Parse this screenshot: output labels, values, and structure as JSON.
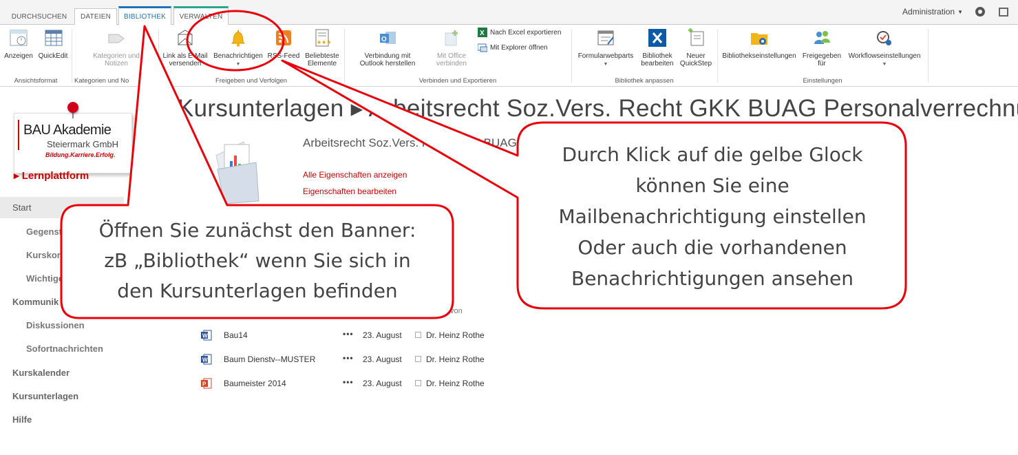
{
  "tabs": [
    {
      "label": "DURCHSUCHEN"
    },
    {
      "label": "DATEIEN"
    },
    {
      "label": "BIBLIOTHEK"
    },
    {
      "label": "VERWALTEN"
    }
  ],
  "header": {
    "user_menu": "Administration"
  },
  "ribbon": {
    "buttons": {
      "anzeigen": "Anzeigen",
      "quickedit": "QuickEdit",
      "kategorien": "Kategorien und Notizen",
      "link_mail": "Link als E-Mail versenden",
      "benachrichtigen": "Benachrichtigen",
      "rss": "RSS-Feed",
      "beliebteste": "Beliebteste Elemente",
      "outlook": "Verbindung mit Outlook herstellen",
      "office": "Mit Office verbinden",
      "excel": "Nach Excel exportieren",
      "explorer": "Mit Explorer öffnen",
      "formular": "Formularwebparts",
      "bibliothek_bearbeiten": "Bibliothek bearbeiten",
      "quickstep": "Neuer QuickStep",
      "bib_einstellungen": "Bibliothekseinstellungen",
      "freigegeben": "Freigegeben für",
      "workflow": "Workflowseinstellungen"
    },
    "groups": {
      "ansichtsformat": "Ansichtsformat",
      "kategorien": "Kategorien und No",
      "freigeben": "Freigeben und Verfolgen",
      "verbinden": "Verbinden und Exportieren",
      "anpassen": "Bibliothek anpassen",
      "einstellungen": "Einstellungen"
    }
  },
  "logo": {
    "line1": "BAU Akademie",
    "line2": "Steiermark GmbH",
    "tagline": "Bildung.Karriere.Erfolg.",
    "platform": "▸ Lernplattform"
  },
  "nav": {
    "start": "Start",
    "gegenst": "Gegenst",
    "kurskon": "Kurskon",
    "wichtige": "Wichtige",
    "kommunik": "Kommunik",
    "diskussionen": "Diskussionen",
    "sofortnachrichten": "Sofortnachrichten",
    "kurskalender": "Kurskalender",
    "kursunterlagen": "Kursunterlagen",
    "hilfe": "Hilfe"
  },
  "main": {
    "title": "Kursunterlagen ▸ Arbeitsrecht Soz.Vers. Recht GKK BUAG Personalverrechnu",
    "doc_title": "Arbeitsrecht Soz.Vers. Recht GKK BUAG",
    "link_all": "Alle Eigenschaften anzeigen",
    "link_edit": "Eigenschaften bearbeiten",
    "col_geaendert_von": "von"
  },
  "files": [
    {
      "name": "Bau14",
      "dots": "•••",
      "date": "23. August",
      "author": "Dr. Heinz Rothe",
      "type": "word"
    },
    {
      "name": "Baum Dienstv--MUSTER",
      "dots": "•••",
      "date": "23. August",
      "author": "Dr. Heinz Rothe",
      "type": "word"
    },
    {
      "name": "Baumeister 2014",
      "dots": "•••",
      "date": "23. August",
      "author": "Dr. Heinz Rothe",
      "type": "ppt"
    }
  ],
  "callouts": {
    "left": [
      "Öffnen Sie zunächst den Banner:",
      "zB „Bibliothek“ wenn Sie sich in",
      "den Kursunterlagen befinden"
    ],
    "right": [
      "Durch Klick auf die gelbe Glock",
      "können Sie eine",
      "Mailbenachrichtigung einstellen",
      "Oder auch die vorhandenen",
      "Benachrichtigungen ansehen"
    ]
  },
  "colors": {
    "accent_blue": "#2072b8",
    "callout_red": "#e8000b",
    "link_red": "#c70000",
    "bell_yellow": "#f2b418",
    "rss_orange": "#f07f22"
  }
}
